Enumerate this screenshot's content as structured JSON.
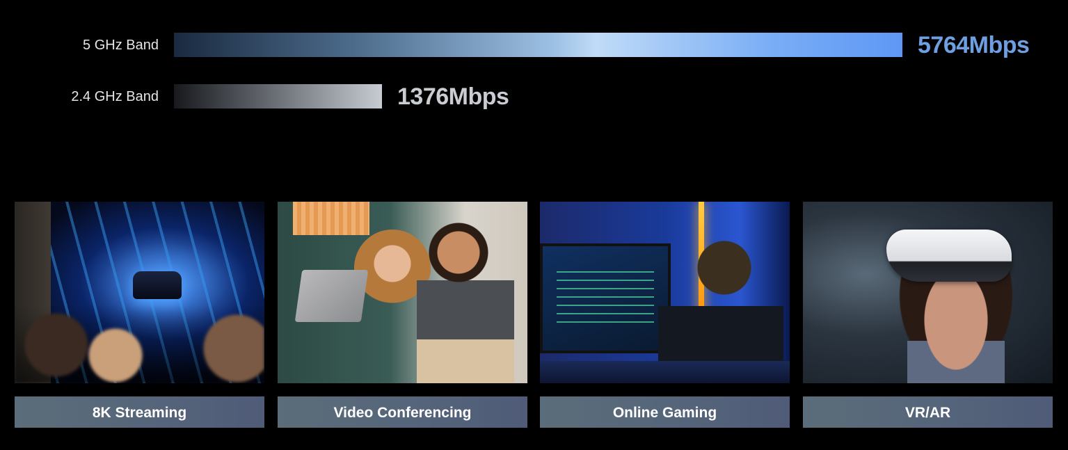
{
  "bands": [
    {
      "label": "5 GHz Band",
      "speed": "5764Mbps",
      "fraction": 1.0,
      "color": "#6f9fe3"
    },
    {
      "label": "2.4 GHz Band",
      "speed": "1376Mbps",
      "fraction": 0.286,
      "color": "#c9ccd2"
    }
  ],
  "use_cases": [
    {
      "label": "8K Streaming",
      "image": "streaming-photo"
    },
    {
      "label": "Video Conferencing",
      "image": "video-conferencing-photo"
    },
    {
      "label": "Online Gaming",
      "image": "gaming-photo"
    },
    {
      "label": "VR/AR",
      "image": "vr-headset-photo"
    }
  ],
  "colors": {
    "background": "#000000",
    "label_bar": "#56667a"
  }
}
